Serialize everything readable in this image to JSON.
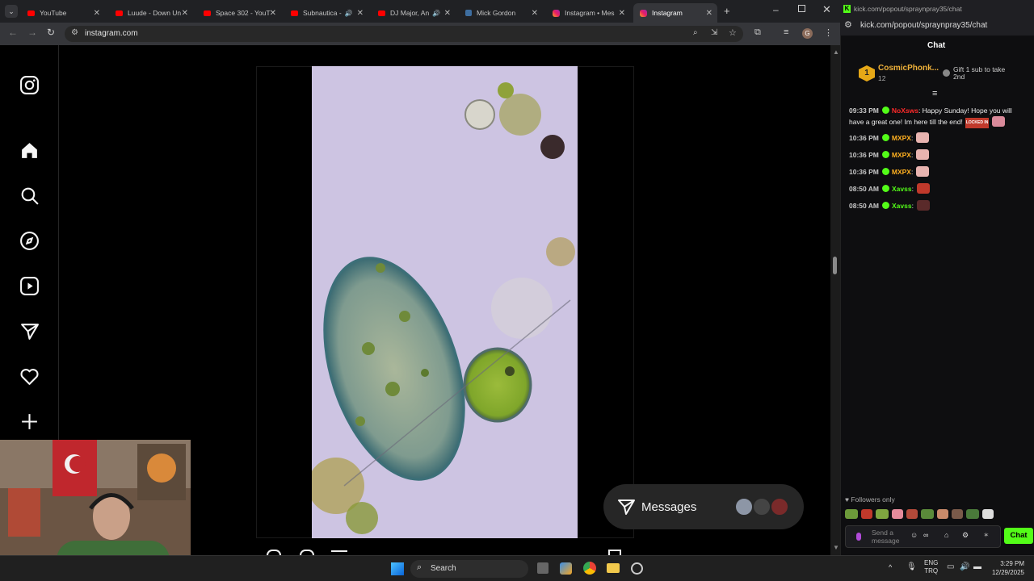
{
  "browser": {
    "tabs": [
      {
        "label": "YouTube",
        "favicon": "youtube-icon"
      },
      {
        "label": "Luude - Down Un",
        "favicon": "youtube-icon"
      },
      {
        "label": "Space 302 - YouT",
        "favicon": "youtube-icon"
      },
      {
        "label": "Subnautica -",
        "favicon": "youtube-icon",
        "audio": true
      },
      {
        "label": "DJ Major, An",
        "favicon": "youtube-icon",
        "audio": true
      },
      {
        "label": "Mick Gordon",
        "favicon": "wikipedia-icon"
      },
      {
        "label": "Instagram • Mes",
        "favicon": "instagram-icon"
      },
      {
        "label": "Instagram",
        "favicon": "instagram-icon",
        "active": true
      }
    ],
    "url": "instagram.com",
    "profile_initial": "G",
    "new_tab": "+",
    "accent": "#35363a"
  },
  "instagram": {
    "sidebar": [
      "instagram-logo-icon",
      "home-icon",
      "search-icon",
      "explore-icon",
      "reels-icon",
      "messages-icon",
      "notifications-icon",
      "create-icon"
    ],
    "messages_label": "Messages",
    "colors": {
      "bg": "#000000",
      "pill": "#262626"
    }
  },
  "kick": {
    "url": "kick.com/popout/spraynpray35/chat",
    "header": "Chat",
    "pinned": {
      "rank": "1",
      "name": "CosmicPhonk...",
      "count": "12",
      "gift_text": "Gift 1 sub to take 2nd"
    },
    "messages": [
      {
        "time": "09:33 PM",
        "user": "NoXsws",
        "color": "#ff2a2a",
        "text": ": Happy Sunday! Hope you will have a great one! Im here till the end!",
        "emote_label": "LOCKED IN"
      },
      {
        "time": "10:36 PM",
        "user": "MXPX",
        "color": "#ffb020",
        "text": ":"
      },
      {
        "time": "10:36 PM",
        "user": "MXPX",
        "color": "#ffb020",
        "text": ":"
      },
      {
        "time": "10:36 PM",
        "user": "MXPX",
        "color": "#ffb020",
        "text": ":"
      },
      {
        "time": "08:50 AM",
        "user": "Xavss",
        "color": "#53fc18",
        "text": ":"
      },
      {
        "time": "08:50 AM",
        "user": "Xavss",
        "color": "#53fc18",
        "text": ":"
      }
    ],
    "followers_only": "Followers only",
    "input_placeholder": "Send a message",
    "chat_button": "Chat",
    "brand": "#53fc18"
  },
  "taskbar": {
    "search": "Search",
    "lang_1": "ENG",
    "lang_2": "TRQ",
    "time": "3:29 PM",
    "date": "12/29/2025"
  }
}
